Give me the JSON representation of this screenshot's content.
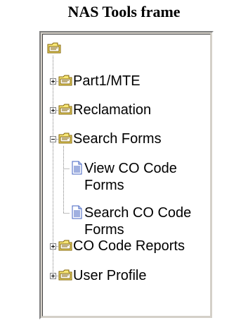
{
  "page_title": "NAS Tools frame",
  "tree": {
    "root_label": "",
    "items": [
      {
        "label": "Part1/MTE",
        "state": "collapsed"
      },
      {
        "label": "Reclamation",
        "state": "collapsed"
      },
      {
        "label": "Search Forms",
        "state": "expanded",
        "children": [
          {
            "label_line1": "View CO Code",
            "label_line2": "Forms"
          },
          {
            "label_line1": "Search CO Code",
            "label_line2": "Forms"
          }
        ]
      },
      {
        "label": "CO Code Reports",
        "state": "collapsed"
      },
      {
        "label": "User Profile",
        "state": "collapsed"
      }
    ]
  },
  "colors": {
    "folder_yellow": "#f8e878",
    "folder_shadow": "#c0a000",
    "frame_face": "#d4d0c8",
    "doc_blue": "#4060c0"
  },
  "icons": [
    "folder-icon",
    "document-icon",
    "plus-toggle-icon",
    "minus-toggle-icon"
  ]
}
